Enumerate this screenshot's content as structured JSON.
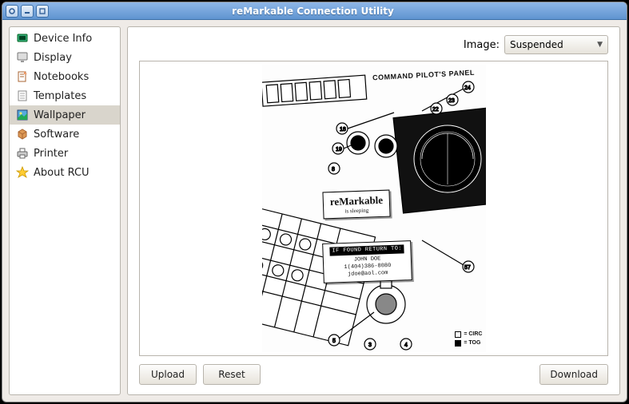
{
  "window": {
    "title": "reMarkable Connection Utility"
  },
  "sidebar": {
    "items": [
      {
        "label": "Device Info",
        "icon": "device-info-icon"
      },
      {
        "label": "Display",
        "icon": "display-icon"
      },
      {
        "label": "Notebooks",
        "icon": "notebooks-icon"
      },
      {
        "label": "Templates",
        "icon": "templates-icon"
      },
      {
        "label": "Wallpaper",
        "icon": "wallpaper-icon",
        "selected": true
      },
      {
        "label": "Software",
        "icon": "software-icon"
      },
      {
        "label": "Printer",
        "icon": "printer-icon"
      },
      {
        "label": "About RCU",
        "icon": "about-icon"
      }
    ]
  },
  "main": {
    "image_label": "Image:",
    "image_selected": "Suspended",
    "buttons": {
      "upload": "Upload",
      "reset": "Reset",
      "download": "Download"
    }
  },
  "preview": {
    "heading": "COMMAND PILOT'S PANEL",
    "brand": "reMarkable",
    "brand_sub": "is sleeping",
    "found_header": "IF FOUND RETURN TO:",
    "found_name": "JOHN DOE",
    "found_phone": "1(404)386-8080",
    "found_email": "jdoe@aol.com",
    "legend_circ": "= CIRC",
    "legend_tog": "= TOG"
  }
}
